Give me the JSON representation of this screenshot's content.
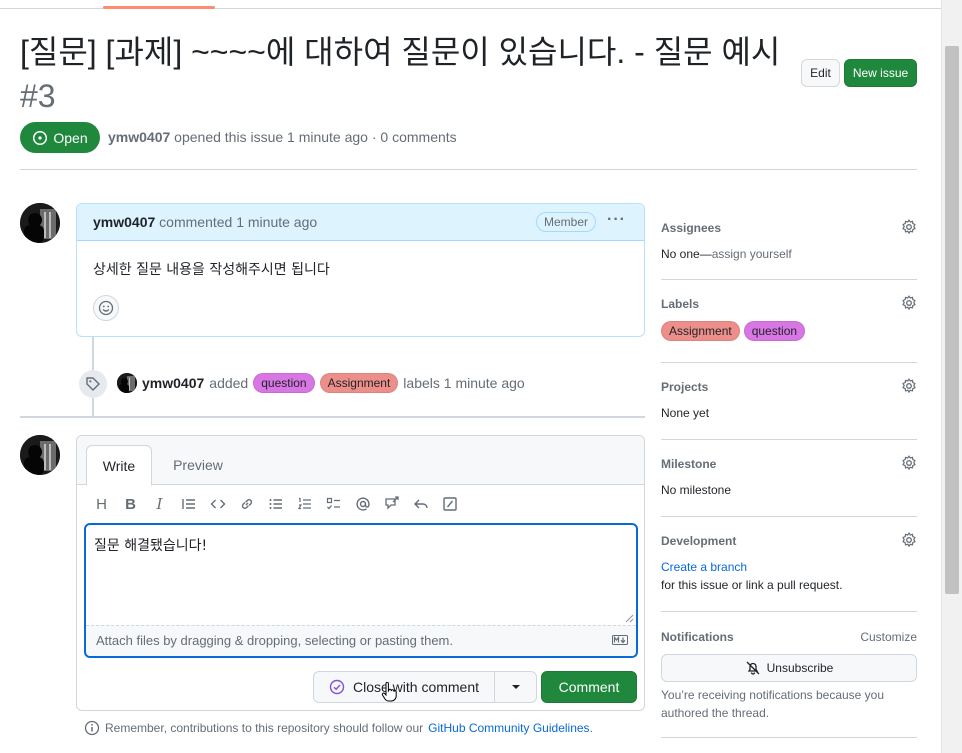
{
  "issue": {
    "title": "[질문] [과제] ~~~~에 대하여 질문이 있습니다. - 질문 예시",
    "number": "#3",
    "state": "Open",
    "author": "ymw0407",
    "meta_text": "opened this issue 1 minute ago · 0 comments"
  },
  "header_buttons": {
    "edit": "Edit",
    "new_issue": "New issue"
  },
  "first_comment": {
    "author": "ymw0407",
    "action": "commented 1 minute ago",
    "role_badge": "Member",
    "more": "···",
    "body": "상세한 질문 내용을 작성해주시면 됩니다"
  },
  "label_event": {
    "author": "ymw0407",
    "verb": "added",
    "labels": [
      "question",
      "Assignment"
    ],
    "suffix": "labels 1 minute ago"
  },
  "editor": {
    "tabs": [
      "Write",
      "Preview"
    ],
    "text": "질문 해결됐습니다!",
    "attach_hint": "Attach files by dragging & dropping, selecting or pasting them.",
    "close_button": "Close with comment",
    "comment_button": "Comment"
  },
  "footer": {
    "note": "Remember, contributions to this repository should follow our",
    "link": "GitHub Community Guidelines",
    "end": "."
  },
  "sidebar": {
    "assignees": {
      "title": "Assignees",
      "value": "No one—",
      "link": "assign yourself"
    },
    "labels": {
      "title": "Labels",
      "items": [
        "Assignment",
        "question"
      ]
    },
    "projects": {
      "title": "Projects",
      "value": "None yet"
    },
    "milestone": {
      "title": "Milestone",
      "value": "No milestone"
    },
    "development": {
      "title": "Development",
      "link": "Create a branch",
      "value": "for this issue or link a pull request."
    },
    "notifications": {
      "title": "Notifications",
      "customize": "Customize",
      "unsubscribe": "Unsubscribe",
      "reason_line1": "You’re receiving notifications because you",
      "reason_line2": "authored the thread."
    }
  },
  "colors": {
    "green": "#1f883d",
    "label_question": "#d876e3",
    "label_assignment": "#ec8f8a",
    "link_blue": "#0969da",
    "comment_header": "#ddf4ff"
  }
}
